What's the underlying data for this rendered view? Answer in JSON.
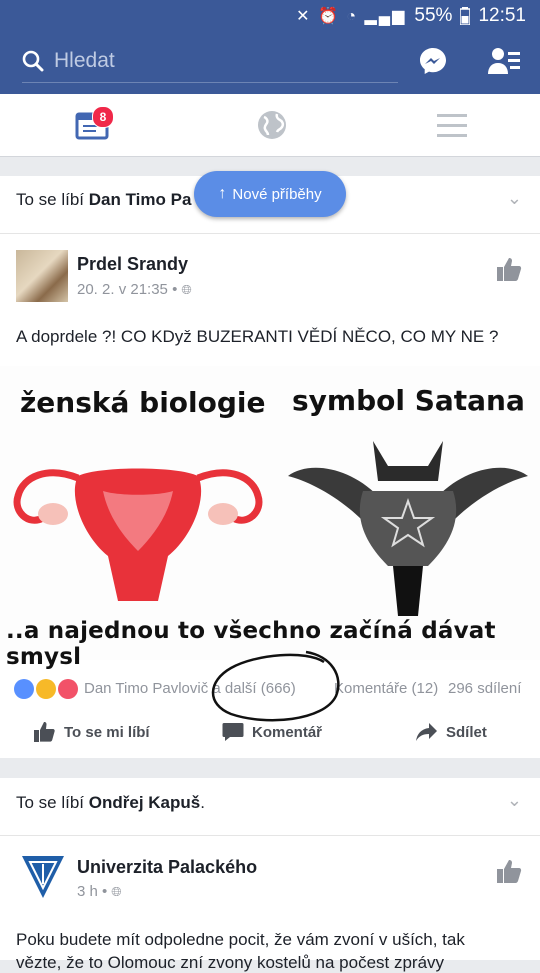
{
  "status_bar": {
    "battery": "55%",
    "time": "12:51"
  },
  "header": {
    "search_placeholder": "Hledat",
    "notification_count": "8"
  },
  "new_stories": "Nové příběhy",
  "story1": {
    "liked_prefix": "To se líbí ",
    "liked_name": "Dan Timo Pa",
    "author": "Prdel Srandy",
    "time": "20. 2. v 21:35 •",
    "text": "A doprdele ?! CO KDyž BUZERANTI VĚDÍ NĚCO, CO MY NE ?",
    "meme": {
      "left_caption": "ženská biologie",
      "right_caption": "symbol Satana",
      "bottom_caption": "..a najednou to všechno začíná dávat smysl"
    },
    "reactions_text": "Dan Timo Pavlovič a další (666)",
    "comments": "Komentáře (12)",
    "shares": "296 sdílení",
    "actions": {
      "like": "To se mi líbí",
      "comment": "Komentář",
      "share": "Sdílet"
    }
  },
  "story2": {
    "liked_prefix": "To se líbí ",
    "liked_name": "Ondřej Kapuš",
    "liked_suffix": ".",
    "author": "Univerzita Palackého",
    "time": "3 h •",
    "text_line1": "Poku budete mít odpoledne pocit, že vám zvoní v uších, tak",
    "text_line2": "vězte, že to Olomouc zní zvony kostelů na počest zprávy"
  },
  "colors": {
    "brand": "#3b5998",
    "accent_pill": "#5b8de6",
    "badge": "#f02849"
  }
}
